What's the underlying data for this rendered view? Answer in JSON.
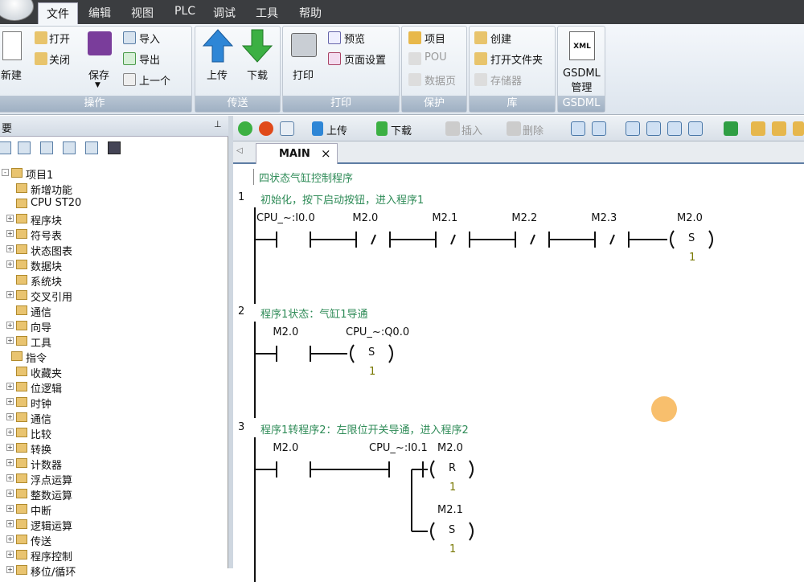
{
  "menubar": {
    "items": [
      "文件",
      "编辑",
      "视图",
      "PLC",
      "调试",
      "工具",
      "帮助"
    ]
  },
  "ribbon": {
    "groups": [
      {
        "title": "操作",
        "buttons": {
          "new": "新建",
          "open": "打开",
          "close": "关闭",
          "save": "保存",
          "import": "导入",
          "export": "导出",
          "previous": "上一个"
        }
      },
      {
        "title": "传送",
        "buttons": {
          "upload": "上传",
          "download": "下载"
        }
      },
      {
        "title": "打印",
        "buttons": {
          "print": "打印",
          "preview": "预览",
          "page_setup": "页面设置"
        }
      },
      {
        "title": "保护",
        "buttons": {
          "project": "项目",
          "pou": "POU",
          "data_page": "数据页"
        }
      },
      {
        "title": "库",
        "buttons": {
          "create": "创建",
          "open_folder": "打开文件夹",
          "memory": "存储器"
        }
      },
      {
        "title": "GSDML",
        "buttons": {
          "gsdml_manage": "GSDML\n管理",
          "xml_label": "XML"
        }
      }
    ]
  },
  "left_panel": {
    "title": "要",
    "pin": "⊥",
    "tree": [
      {
        "label": "项目1",
        "level": 0,
        "expand": "-"
      },
      {
        "label": "新增功能",
        "level": 1,
        "expand": ""
      },
      {
        "label": "CPU ST20",
        "level": 1,
        "expand": ""
      },
      {
        "label": "程序块",
        "level": 1,
        "expand": "+"
      },
      {
        "label": "符号表",
        "level": 1,
        "expand": "+"
      },
      {
        "label": "状态图表",
        "level": 1,
        "expand": "+"
      },
      {
        "label": "数据块",
        "level": 1,
        "expand": "+"
      },
      {
        "label": "系统块",
        "level": 1,
        "expand": ""
      },
      {
        "label": "交叉引用",
        "level": 1,
        "expand": "+"
      },
      {
        "label": "通信",
        "level": 1,
        "expand": ""
      },
      {
        "label": "向导",
        "level": 1,
        "expand": "+"
      },
      {
        "label": "工具",
        "level": 1,
        "expand": "+"
      },
      {
        "label": "指令",
        "level": 0,
        "expand": ""
      },
      {
        "label": "收藏夹",
        "level": 1,
        "expand": ""
      },
      {
        "label": "位逻辑",
        "level": 1,
        "expand": "+"
      },
      {
        "label": "时钟",
        "level": 1,
        "expand": "+"
      },
      {
        "label": "通信",
        "level": 1,
        "expand": "+"
      },
      {
        "label": "比较",
        "level": 1,
        "expand": "+"
      },
      {
        "label": "转换",
        "level": 1,
        "expand": "+"
      },
      {
        "label": "计数器",
        "level": 1,
        "expand": "+"
      },
      {
        "label": "浮点运算",
        "level": 1,
        "expand": "+"
      },
      {
        "label": "整数运算",
        "level": 1,
        "expand": "+"
      },
      {
        "label": "中断",
        "level": 1,
        "expand": "+"
      },
      {
        "label": "逻辑运算",
        "level": 1,
        "expand": "+"
      },
      {
        "label": "传送",
        "level": 1,
        "expand": "+"
      },
      {
        "label": "程序控制",
        "level": 1,
        "expand": "+"
      },
      {
        "label": "移位/循环",
        "level": 1,
        "expand": "+"
      }
    ]
  },
  "editor_toolbar": {
    "upload": "上传",
    "download": "下载",
    "insert": "插入",
    "delete": "删除"
  },
  "tab": {
    "label": "MAIN",
    "close": "×",
    "scroll": "◁"
  },
  "ladder": {
    "program_comment": "四状态气缸控制程序",
    "networks": [
      {
        "num": "1",
        "comment": "初始化，按下启动按钮，进入程序1",
        "contacts": [
          {
            "op": "CPU_~:I0.0",
            "type": "NO"
          },
          {
            "op": "M2.0",
            "type": "NC",
            "sym": "/"
          },
          {
            "op": "M2.1",
            "type": "NC",
            "sym": "/"
          },
          {
            "op": "M2.2",
            "type": "NC",
            "sym": "/"
          },
          {
            "op": "M2.3",
            "type": "NC",
            "sym": "/"
          }
        ],
        "coils": [
          {
            "op": "M2.0",
            "type": "S",
            "n": "1"
          }
        ]
      },
      {
        "num": "2",
        "comment": "程序1状态：气缸1导通",
        "contacts": [
          {
            "op": "M2.0",
            "type": "NO"
          }
        ],
        "coils": [
          {
            "op": "CPU_~:Q0.0",
            "type": "S",
            "n": "1"
          }
        ]
      },
      {
        "num": "3",
        "comment": "程序1转程序2：左限位开关导通，进入程序2",
        "contacts": [
          {
            "op": "M2.0",
            "type": "NO"
          },
          {
            "op": "CPU_~:I0.1",
            "type": "NO"
          }
        ],
        "coils": [
          {
            "op": "M2.0",
            "type": "R",
            "n": "1"
          },
          {
            "op": "M2.1",
            "type": "S",
            "n": "1"
          }
        ]
      }
    ]
  },
  "colors": {
    "accent": "#5e7da3",
    "comment": "#2e8b57",
    "ribbon_title": "#9fb0c3"
  }
}
